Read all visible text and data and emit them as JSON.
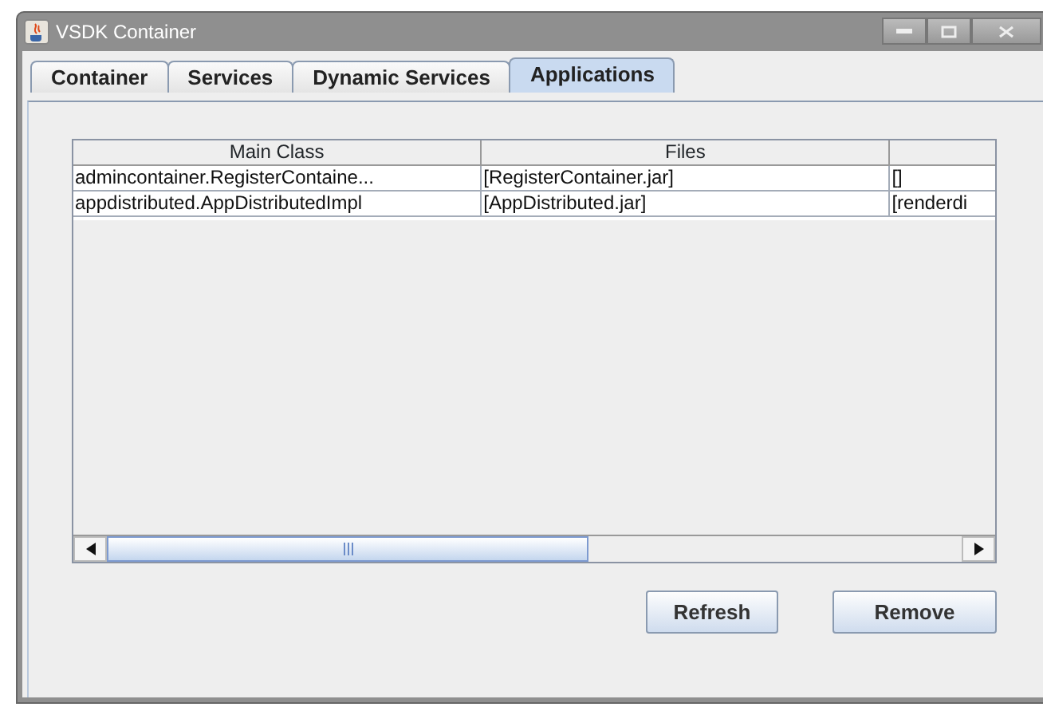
{
  "window": {
    "title": "VSDK Container"
  },
  "tabs": [
    {
      "label": "Container",
      "selected": false
    },
    {
      "label": "Services",
      "selected": false
    },
    {
      "label": "Dynamic Services",
      "selected": false
    },
    {
      "label": "Applications",
      "selected": true
    }
  ],
  "table": {
    "columns": [
      "Main Class",
      "Files",
      ""
    ],
    "rows": [
      [
        "admincontainer.RegisterContaine...",
        "[RegisterContainer.jar]",
        "[]"
      ],
      [
        "appdistributed.AppDistributedImpl",
        "[AppDistributed.jar]",
        "[renderdi"
      ]
    ]
  },
  "buttons": [
    "Refresh",
    "Remove"
  ]
}
